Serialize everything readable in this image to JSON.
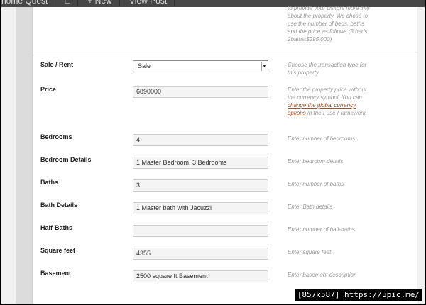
{
  "adminbar": {
    "items": [
      "home Quest",
      "",
      "+ New",
      "View Post"
    ]
  },
  "top_description": "to provide your visitors more info about the property. We chose to use the number of beds, baths and the price as follows (3 beds, 2baths:$295,000)",
  "sale_rent": {
    "label": "Sale / Rent",
    "selected": "Sale",
    "description": "Choose the transaction type for this property"
  },
  "price": {
    "label": "Price",
    "value": "6890000",
    "description_pre": "Enter the property price without the currency symbol. You can ",
    "description_link": "change the global currency options",
    "description_post": " in the Fuse Framework."
  },
  "bedrooms": {
    "label": "Bedrooms",
    "value": "4",
    "description": "Enter number of bedrooms"
  },
  "bedroom_details": {
    "label": "Bedroom Details",
    "value": "1 Master Bedroom, 3 Bedrooms",
    "description": "Enter bedroom details"
  },
  "baths": {
    "label": "Baths",
    "value": "3",
    "description": "Enter number of baths"
  },
  "bath_details": {
    "label": "Bath Details",
    "value": "1 Master bath with Jacuzzi",
    "description": "Enter Bath details"
  },
  "half_baths": {
    "label": "Half-Baths",
    "value": "",
    "description": "Enter number of half-baths"
  },
  "square_feet": {
    "label": "Square feet",
    "value": "4355",
    "description": "Enter square feet"
  },
  "basement": {
    "label": "Basement",
    "value": "2500 square ft Basement",
    "description": "Enter basement description"
  },
  "watermark": "[857x587] https://upic.me/"
}
